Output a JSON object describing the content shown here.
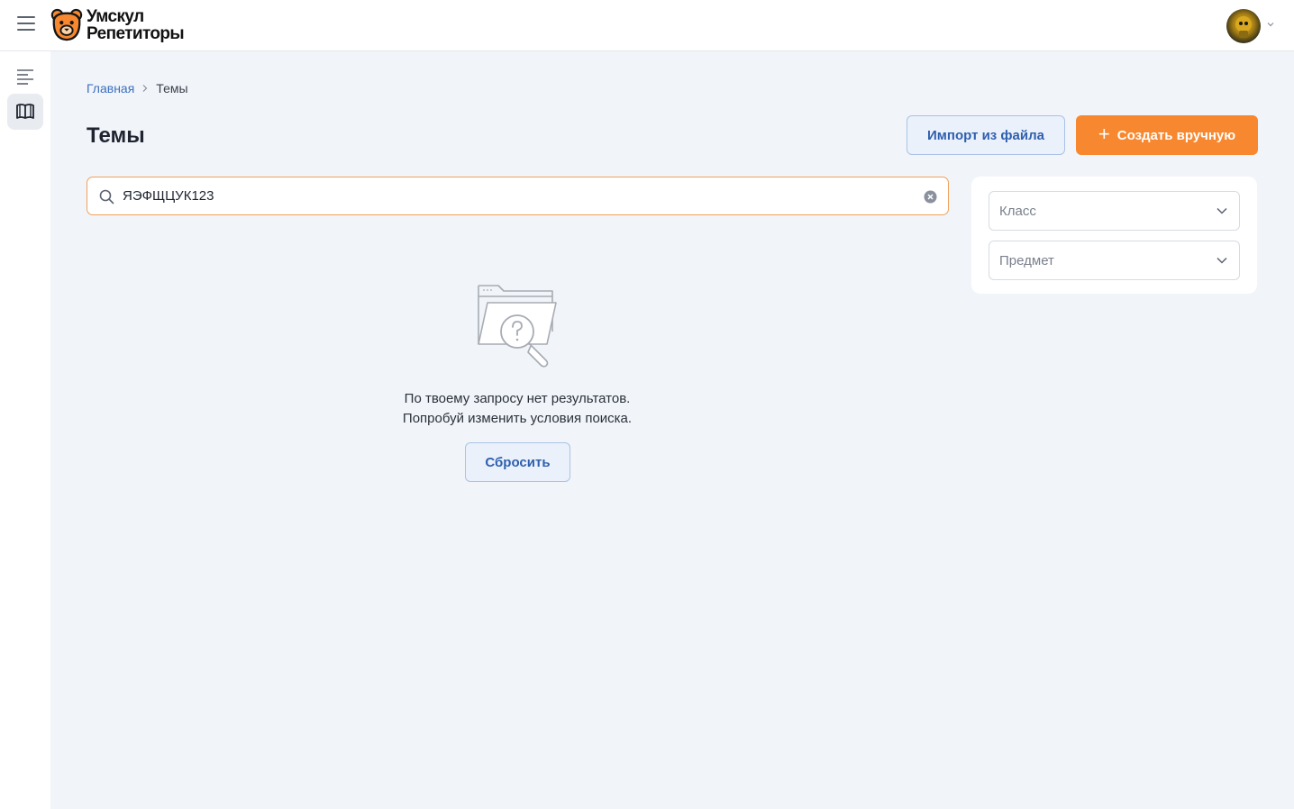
{
  "header": {
    "logo_line1": "Умскул",
    "logo_line2": "Репетиторы",
    "menu_icon": "hamburger-icon",
    "avatar_icon": "user-avatar",
    "brand_color": "#f7882f"
  },
  "sidebar": {
    "items": [
      {
        "icon": "list-icon"
      },
      {
        "icon": "book-icon",
        "active": true
      }
    ]
  },
  "breadcrumb": {
    "home": "Главная",
    "current": "Темы"
  },
  "page": {
    "title": "Темы",
    "import_label": "Импорт из файла",
    "create_label": "Создать вручную"
  },
  "search": {
    "value": "ЯЭФЩЦУК123"
  },
  "filters": {
    "class_placeholder": "Класс",
    "subject_placeholder": "Предмет"
  },
  "empty_state": {
    "line1": "По твоему запросу нет результатов.",
    "line2": "Попробуй изменить условия поиска.",
    "reset_label": "Сбросить"
  }
}
